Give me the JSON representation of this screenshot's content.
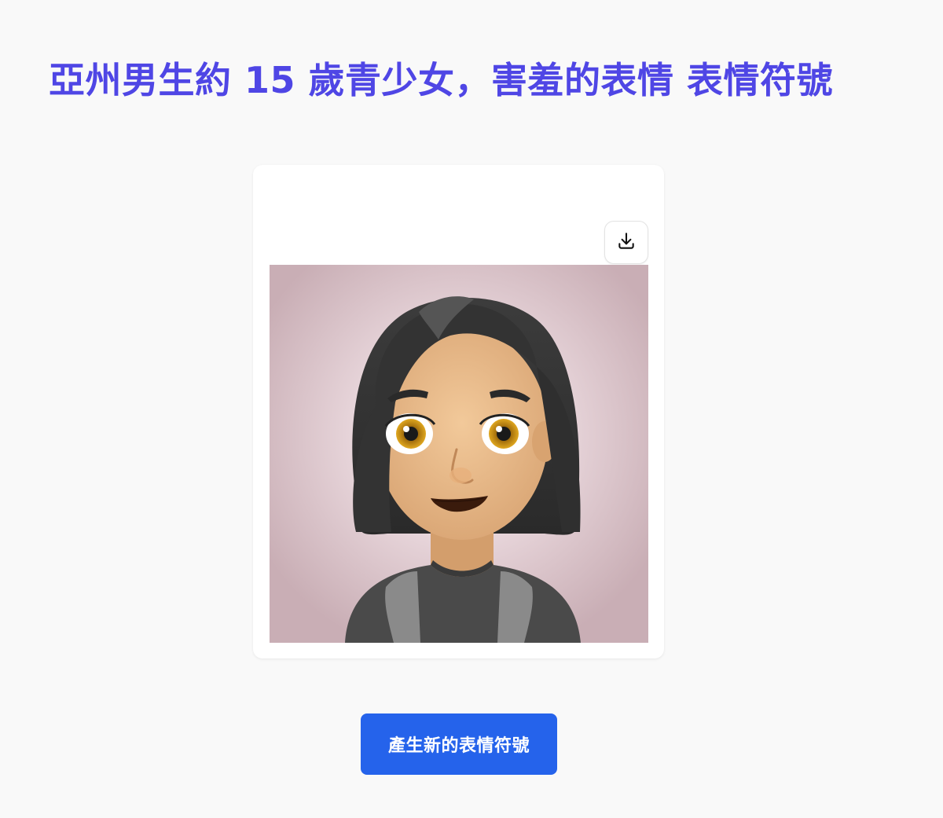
{
  "page": {
    "title": "亞州男生約 15 歲青少女，害羞的表情 表情符號"
  },
  "card": {
    "download_icon": "download-icon",
    "image_subject": "emoji-avatar"
  },
  "actions": {
    "generate_label": "產生新的表情符號"
  },
  "colors": {
    "title": "#4f46e5",
    "button": "#2563eb",
    "image_background": "#cdb4bb",
    "background": "#f9f9f9"
  }
}
